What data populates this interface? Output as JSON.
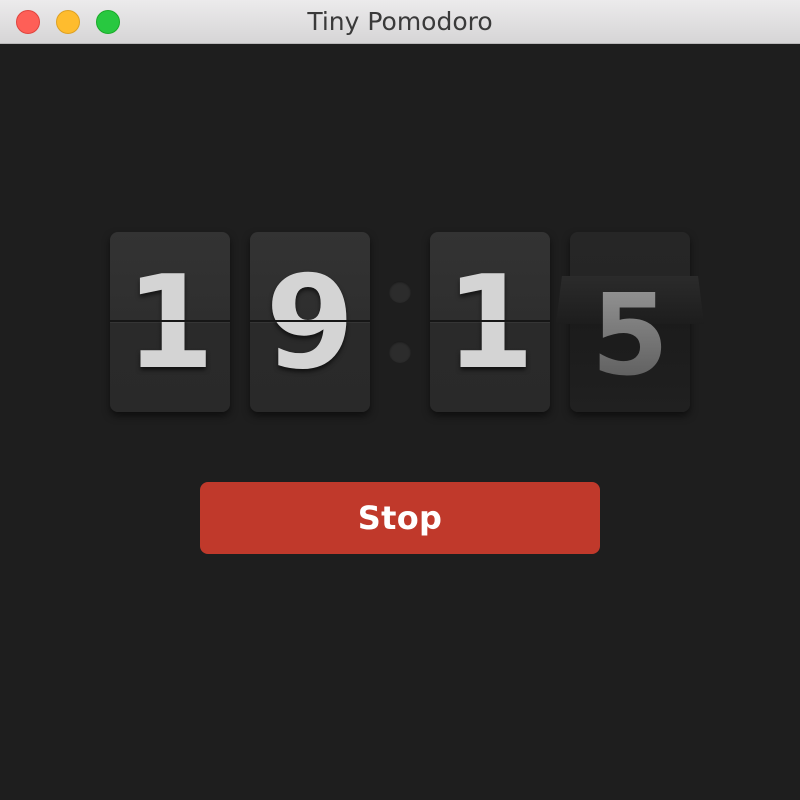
{
  "window": {
    "title": "Tiny Pomodoro",
    "controls": [
      "close",
      "minimize",
      "maximize"
    ]
  },
  "timer": {
    "minutes_tens": "1",
    "minutes_ones": "9",
    "seconds_tens": "1",
    "seconds_ones": "5",
    "separator_dots": 2
  },
  "actions": {
    "stop_label": "Stop"
  },
  "colors": {
    "background": "#1e1e1e",
    "card": "#2e2e2e",
    "digit": "#d4d4d4",
    "stop_button": "#c0392b"
  }
}
